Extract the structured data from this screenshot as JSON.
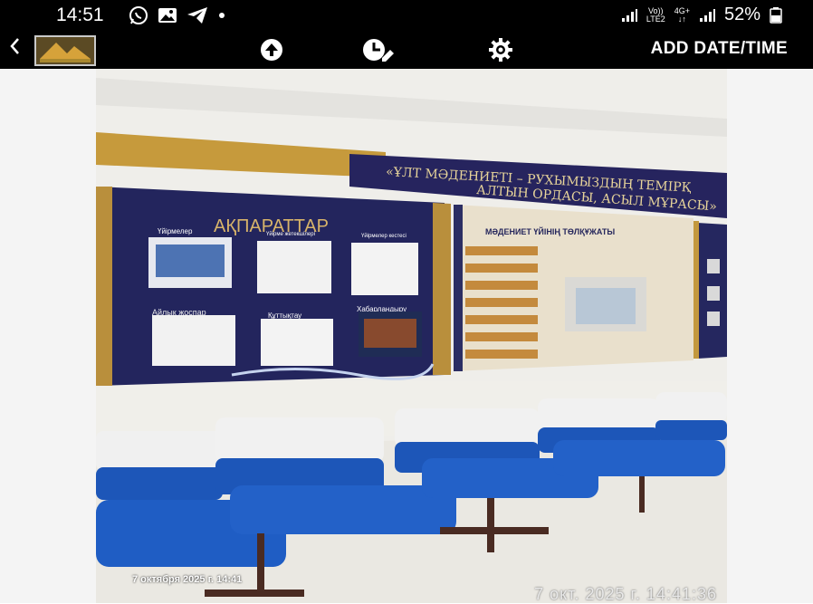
{
  "status_bar": {
    "time": "14:51",
    "carrier_line1": "Vo))",
    "carrier_line2": "LTE2",
    "network_line1": "4G+",
    "network_line2": "↓↑",
    "battery": "52%"
  },
  "toolbar": {
    "action_label": "ADD DATE/TIME"
  },
  "photo": {
    "banner_line1": "«ҰЛТ МӘДЕНИЕТІ – РУХЫМЫЗДЫҢ ТЕМІРҚ",
    "banner_line2": "АЛТЫН ОРДАСЫ, АСЫЛ МҰРАСЫ»",
    "left_board": {
      "title": "АҚПАРАТТАР",
      "captions": [
        "Үйірмелер",
        "Үйірме жетекшілері",
        "Үйірмелер кестесі",
        "Айлық жоспар",
        "Құттықтау",
        "Хабарландыру"
      ]
    },
    "middle_board": {
      "title": "МӘДЕНИЕТ ҮЙІНІҢ ТӨЛҚҰЖАТЫ"
    }
  },
  "stamps": {
    "overlay_date": "7 октября 2025 г. 14:41",
    "camera_date": "7 окт. 2025 г. 14:41:36"
  }
}
